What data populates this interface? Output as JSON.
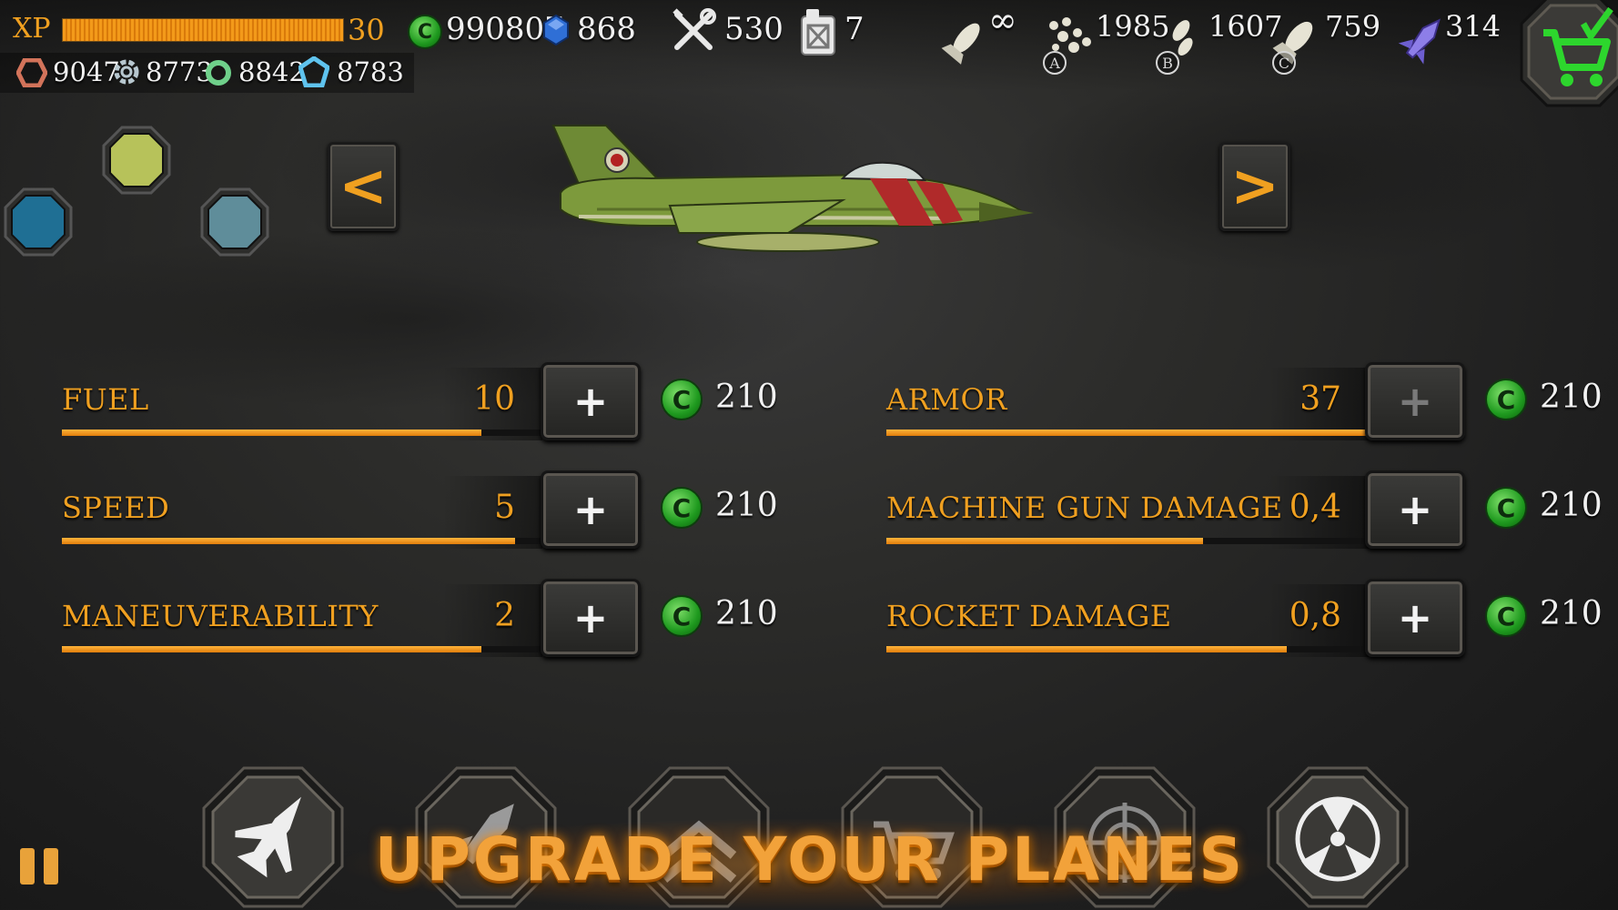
{
  "hud": {
    "xp_label": "XP",
    "xp_value": "30",
    "xp_progress": 1.0,
    "coins": "990807",
    "gems": "868",
    "wrench": "530",
    "fuel_can": "7",
    "bomb_infinite": "∞",
    "ammo_a": "1985",
    "ammo_b": "1607",
    "ammo_c": "759",
    "missiles": "314",
    "ammo_a_letter": "A",
    "ammo_b_letter": "B",
    "ammo_c_letter": "C",
    "parts": [
      "9047",
      "8773",
      "8842",
      "8783"
    ],
    "coin_symbol": "C"
  },
  "colors": {
    "accent_orange": "#f0a020",
    "coin_green": "#1f9a1f",
    "swatch_yellow_green": "#b7c25a",
    "swatch_blue": "#1f6f94",
    "swatch_teal": "#5f8d9a"
  },
  "nav": {
    "prev_label": "<",
    "next_label": ">"
  },
  "stats": {
    "left": [
      {
        "label": "FUEL",
        "value": "10",
        "level": 0.86,
        "price": "210",
        "plus": "+"
      },
      {
        "label": "SPEED",
        "value": "5",
        "level": 0.93,
        "price": "210",
        "plus": "+"
      },
      {
        "label": "MANEUVERABILITY",
        "value": "2",
        "level": 0.86,
        "price": "210",
        "plus": "+"
      }
    ],
    "right": [
      {
        "label": "ARMOR",
        "value": "37",
        "level": 0.99,
        "price": "210",
        "plus": "+"
      },
      {
        "label": "MACHINE GUN DAMAGE",
        "value": "0,4",
        "level": 0.65,
        "price": "210",
        "plus": "+"
      },
      {
        "label": "ROCKET DAMAGE",
        "value": "0,8",
        "level": 0.82,
        "price": "210",
        "plus": "+"
      }
    ]
  },
  "bottom": {
    "banner": "UPGRADE YOUR PLANES",
    "tabs": [
      "plane-icon",
      "missile-icon",
      "rank-chevron-icon",
      "shop-cart-icon",
      "radar-icon",
      "radiation-icon"
    ]
  }
}
